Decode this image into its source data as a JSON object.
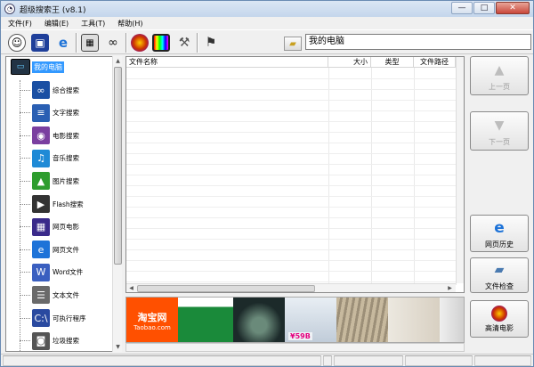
{
  "window": {
    "title": "超级搜索王 (v8.1)",
    "buttons": {
      "minimize": "—",
      "maximize": "□",
      "close": "✕"
    }
  },
  "menu": [
    "文件(F)",
    "编辑(E)",
    "工具(T)",
    "帮助(H)"
  ],
  "toolbar": {
    "icons": [
      "search-globe-icon",
      "save-disk-icon",
      "ie-browser-icon",
      "calculator-icon",
      "binoculars-icon",
      "film-reel-icon",
      "tv-color-icon",
      "tools-icon",
      "exit-icon"
    ],
    "folder_icon": "folder-open-icon",
    "path_value": "我的电脑"
  },
  "tree": {
    "root_label": "我的电脑",
    "items": [
      {
        "label": "综合搜索",
        "icon": "binoculars-icon",
        "color": "#1a4fa3"
      },
      {
        "label": "文字搜索",
        "icon": "text-doc-icon",
        "color": "#2a5fb3"
      },
      {
        "label": "电影搜索",
        "icon": "film-reel-icon",
        "color": "#7a3fa0"
      },
      {
        "label": "音乐搜索",
        "icon": "music-note-icon",
        "color": "#1f8ad6"
      },
      {
        "label": "图片搜索",
        "icon": "landscape-picture-icon",
        "color": "#2e9d2e"
      },
      {
        "label": "Flash搜索",
        "icon": "flash-movie-icon",
        "color": "#333333"
      },
      {
        "label": "网页电影",
        "icon": "tv-color-icon",
        "color": "#3a2a8a"
      },
      {
        "label": "网页文件",
        "icon": "ie-browser-icon",
        "color": "#1e73d8"
      },
      {
        "label": "Word文件",
        "icon": "word-doc-icon",
        "color": "#3a5fc0"
      },
      {
        "label": "文本文件",
        "icon": "text-file-icon",
        "color": "#6a6a6a"
      },
      {
        "label": "可执行程序",
        "icon": "exe-window-icon",
        "color": "#2a4aa0"
      },
      {
        "label": "垃圾搜索",
        "icon": "trash-can-icon",
        "color": "#555555"
      }
    ]
  },
  "list": {
    "columns": [
      "文件名称",
      "大小",
      "类型",
      "文件路径"
    ],
    "rows": []
  },
  "ad_banner": {
    "logo_title": "淘宝网",
    "logo_sub": "Taobao.com",
    "price": "¥59B",
    "tiles": [
      "#1a8a3a",
      "#2a3a3a",
      "#cfd9e4",
      "#b8b0a0",
      "#d9d2c4",
      "#e6e6e6"
    ]
  },
  "right_buttons": [
    {
      "label": "上一页",
      "icon": "arrow-up-icon",
      "enabled": false
    },
    {
      "label": "下一页",
      "icon": "arrow-down-icon",
      "enabled": false
    },
    {
      "label": "网页历史",
      "icon": "ie-browser-icon",
      "enabled": true
    },
    {
      "label": "文件检查",
      "icon": "folder-check-icon",
      "enabled": true
    },
    {
      "label": "高清电影",
      "icon": "film-reel-icon",
      "enabled": true
    }
  ],
  "colors": {
    "accent_selection": "#3399ff",
    "taobao_orange": "#ff5000"
  }
}
